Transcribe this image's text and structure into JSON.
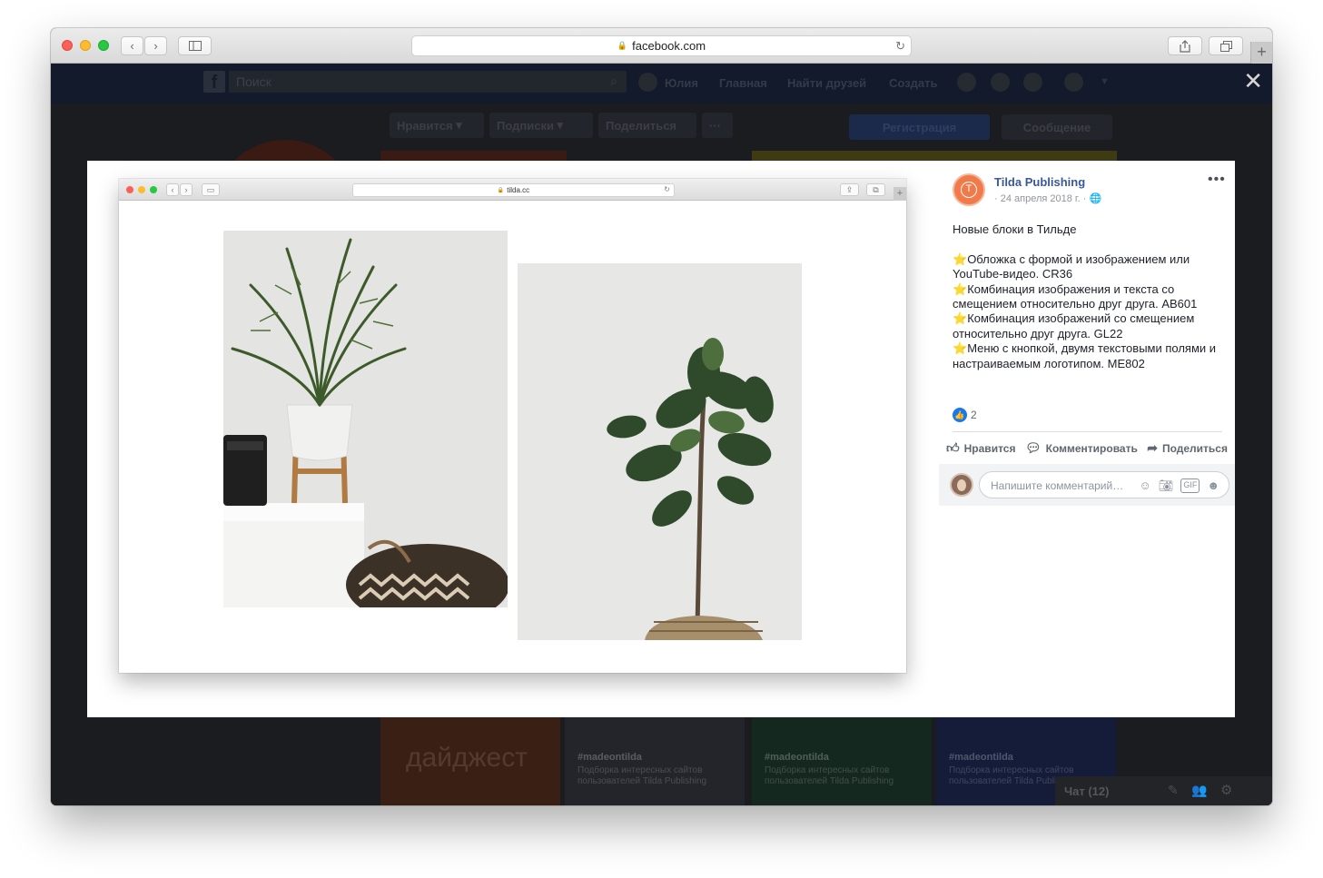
{
  "browser": {
    "url": "facebook.com",
    "tabs_badge": "+"
  },
  "facebook": {
    "search_placeholder": "Поиск",
    "nav": {
      "user": "Юлия",
      "home": "Главная",
      "find_friends": "Найти друзей",
      "create": "Создать"
    },
    "page_buttons": {
      "like": "Нравится",
      "follow": "Подписки",
      "share": "Поделиться",
      "more": "···",
      "register": "Регистрация",
      "message": "Сообщение"
    },
    "bg_cards": [
      {
        "title": "дайджест",
        "tag": "",
        "desc": ""
      },
      {
        "title": "",
        "tag": "#madeontilda",
        "desc": "Подборка интересных сайтов пользователей Tilda Publishing"
      },
      {
        "title": "",
        "tag": "#madeontilda",
        "desc": "Подборка интересных сайтов пользователей Tilda Publishing"
      },
      {
        "title": "",
        "tag": "#madeontilda",
        "desc": "Подборка интересных сайтов пользователей Tilda Publishing"
      }
    ],
    "chat_label": "Чат (12)"
  },
  "post": {
    "inner_url": "tilda.cc",
    "page_name": "Tilda Publishing",
    "date": "24 апреля 2018 г.",
    "title": "Новые блоки в Тильде",
    "lines": [
      "Обложка с формой и изображением или YouTube-видео. CR36",
      "Комбинация изображения и текста со смещением относительно друг друга. AB601",
      "Комбинация изображений со смещением относительно друг друга. GL22",
      "Меню с кнопкой, двумя текстовыми полями и настраиваемым логотипом. ME802"
    ],
    "like_count": "2",
    "actions": {
      "like": "Нравится",
      "comment": "Комментировать",
      "share": "Поделиться"
    },
    "comment_placeholder": "Напишите комментарий…"
  },
  "icons": {
    "close": "close-icon",
    "like": "thumb-up-icon",
    "comment": "speech-bubble-icon",
    "share": "share-arrow-icon",
    "globe": "globe-icon"
  },
  "colors": {
    "facebook_link": "#385898",
    "tilda_orange": "#f07a4a",
    "like_blue": "#1877f2"
  }
}
